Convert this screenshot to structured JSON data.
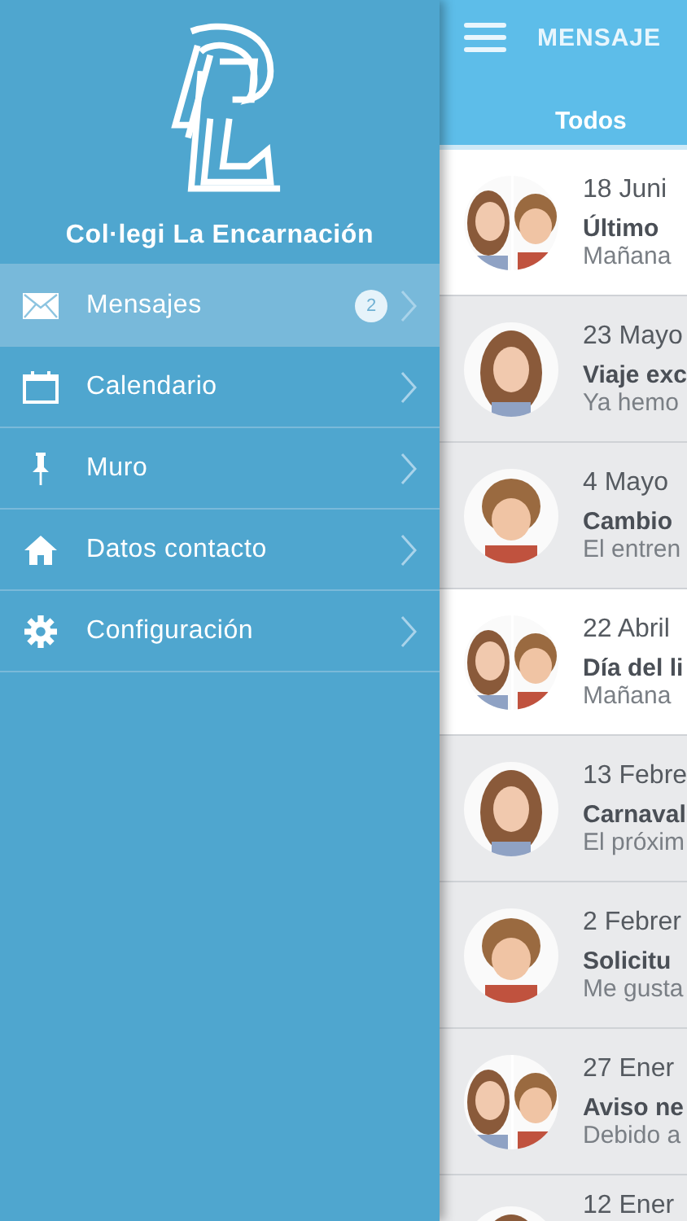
{
  "drawer": {
    "school_name": "Col·legi La Encarnación",
    "items": [
      {
        "label": "Mensajes",
        "badge": "2",
        "selected": true
      },
      {
        "label": "Calendario",
        "selected": false
      },
      {
        "label": "Muro",
        "selected": false
      },
      {
        "label": "Datos contacto",
        "selected": false
      },
      {
        "label": "Configuración",
        "selected": false
      }
    ]
  },
  "header": {
    "title": "MENSAJE",
    "tabs": [
      {
        "label": "Todos",
        "selected": true
      }
    ]
  },
  "messages": [
    {
      "date": "18 Juni",
      "title": "Último",
      "preview": "Mañana",
      "unread": true
    },
    {
      "date": "23 Mayo",
      "title": "Viaje exc",
      "preview": "Ya hemo",
      "unread": false
    },
    {
      "date": "4 Mayo",
      "title": "Cambio",
      "preview": "El entren",
      "unread": false
    },
    {
      "date": "22 Abril",
      "title": "Día del li",
      "preview": "Mañana",
      "unread": true
    },
    {
      "date": "13 Febre",
      "title": "Carnaval",
      "preview": "El próxim",
      "unread": false
    },
    {
      "date": "2 Febrer",
      "title": "Solicitu",
      "preview": "Me gusta",
      "unread": false
    },
    {
      "date": "27 Ener",
      "title": "Aviso ne",
      "preview": "Debido a",
      "unread": false
    },
    {
      "date": "12 Ener",
      "unread": false
    }
  ]
}
